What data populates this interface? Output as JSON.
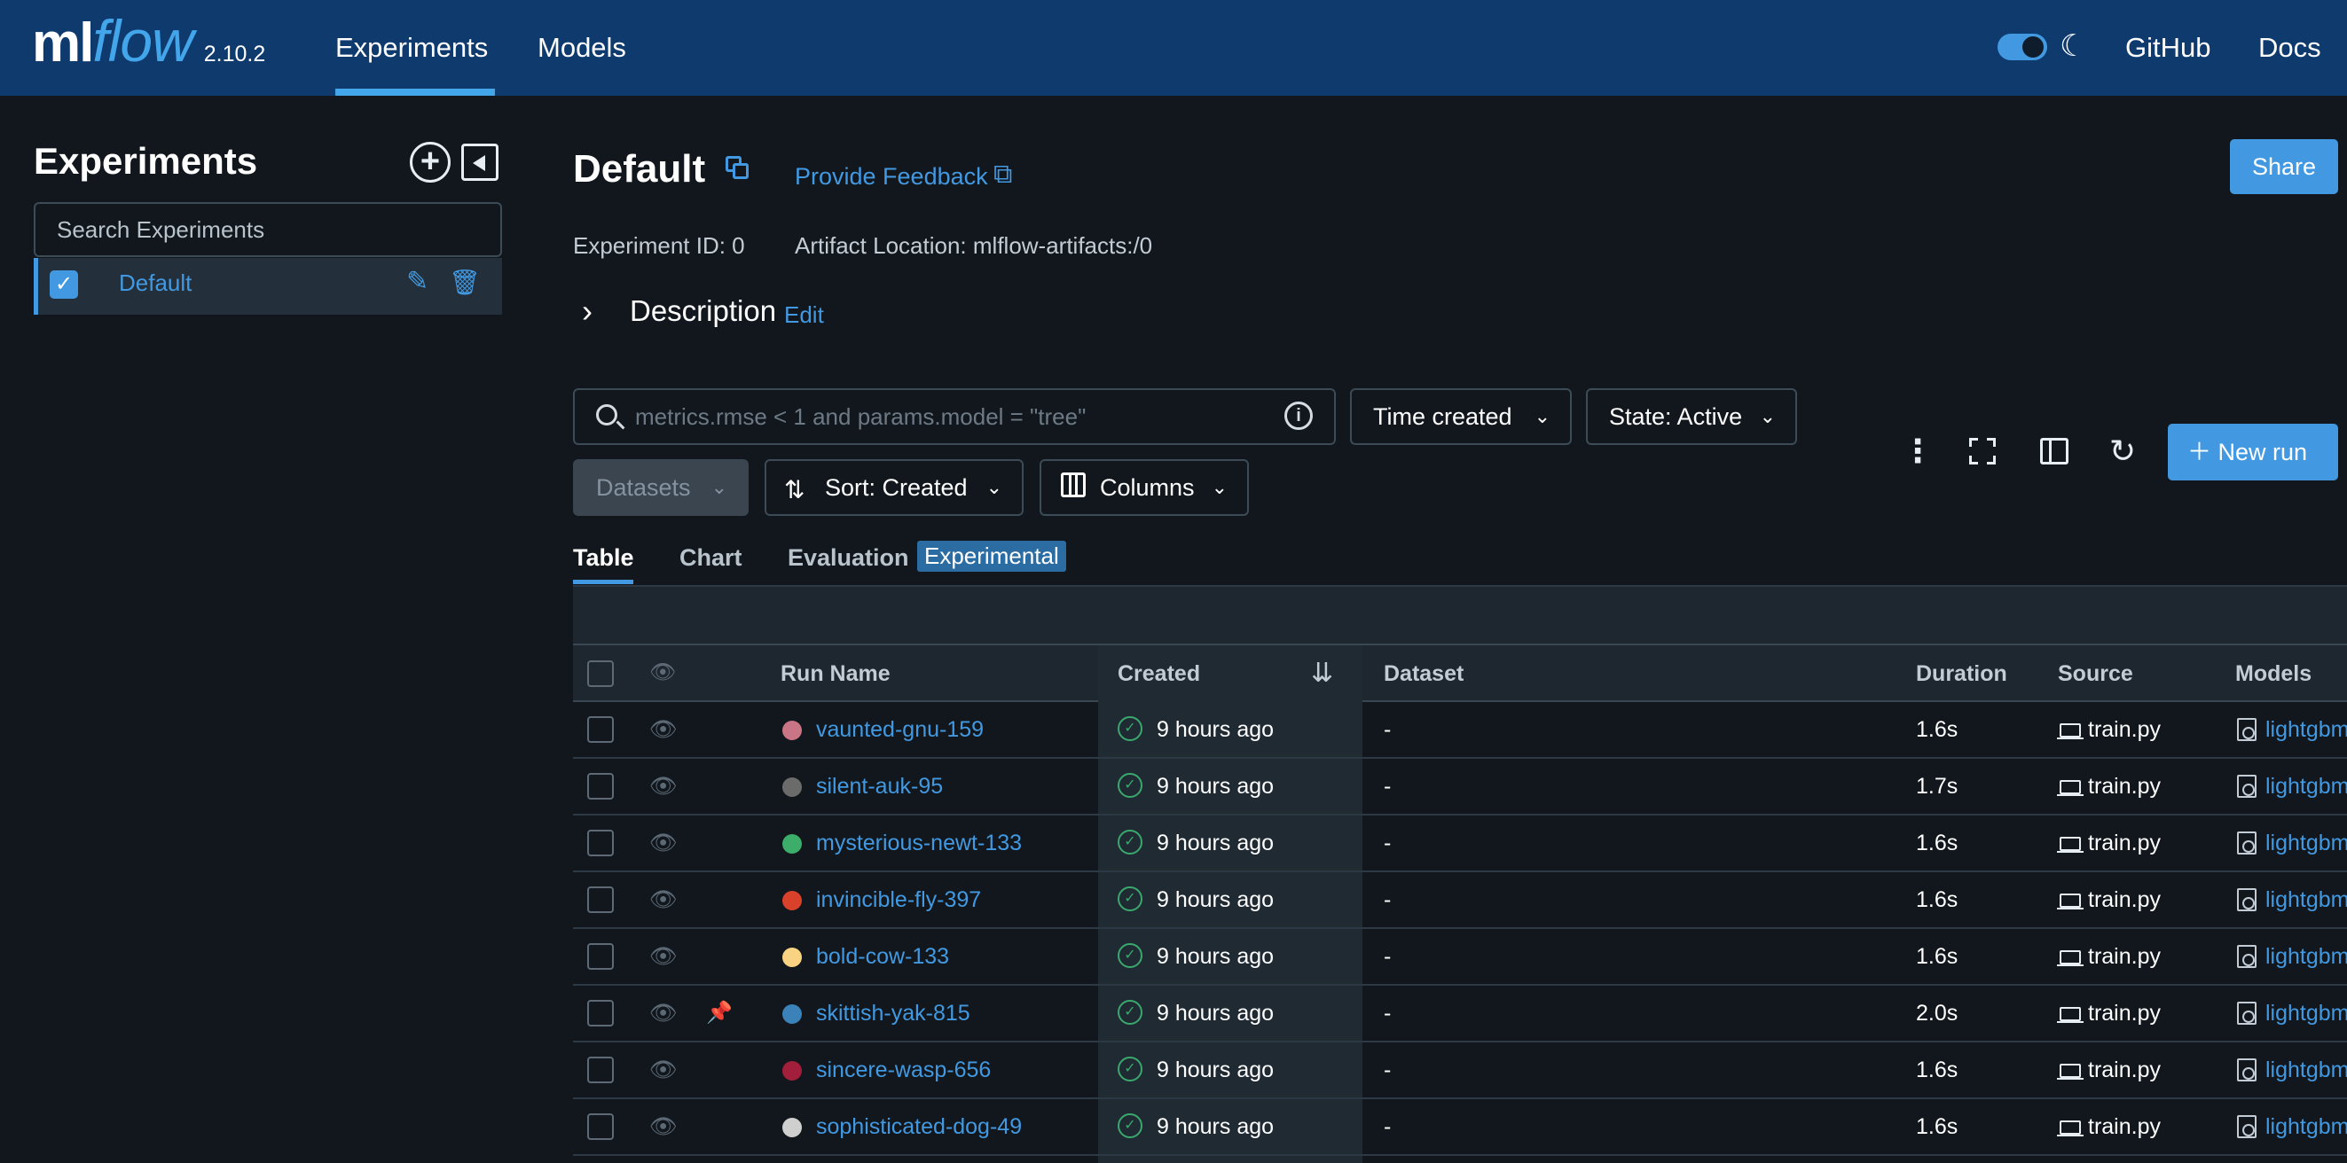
{
  "nav": {
    "logo_ml": "ml",
    "logo_flow": "flow",
    "version": "2.10.2",
    "experiments": "Experiments",
    "models": "Models",
    "github": "GitHub",
    "docs": "Docs"
  },
  "sidebar": {
    "title": "Experiments",
    "search_placeholder": "Search Experiments",
    "items": [
      {
        "label": "Default",
        "checked": true
      }
    ]
  },
  "header": {
    "title": "Default",
    "feedback": "Provide Feedback",
    "share": "Share",
    "experiment_id": "Experiment ID: 0",
    "artifact_location": "Artifact Location: mlflow-artifacts:/0",
    "description": "Description",
    "edit": "Edit"
  },
  "filters": {
    "search_placeholder": "metrics.rmse < 1 and params.model = \"tree\"",
    "time_created": "Time created",
    "state": "State: Active",
    "datasets": "Datasets",
    "sort": "Sort: Created",
    "columns": "Columns",
    "new_run": "New run"
  },
  "tabs": {
    "table": "Table",
    "chart": "Chart",
    "evaluation": "Evaluation",
    "experimental": "Experimental"
  },
  "table": {
    "columns": {
      "run_name": "Run Name",
      "created": "Created",
      "dataset": "Dataset",
      "duration": "Duration",
      "source": "Source",
      "models": "Models"
    },
    "rows": [
      {
        "name": "vaunted-gnu-159",
        "color": "#c97585",
        "created": "9 hours ago",
        "dataset": "-",
        "duration": "1.6s",
        "source": "train.py",
        "model": "lightgbm"
      },
      {
        "name": "silent-auk-95",
        "color": "#6b6b6b",
        "created": "9 hours ago",
        "dataset": "-",
        "duration": "1.7s",
        "source": "train.py",
        "model": "lightgbm"
      },
      {
        "name": "mysterious-newt-133",
        "color": "#3dae6a",
        "created": "9 hours ago",
        "dataset": "-",
        "duration": "1.6s",
        "source": "train.py",
        "model": "lightgbm"
      },
      {
        "name": "invincible-fly-397",
        "color": "#d9412b",
        "created": "9 hours ago",
        "dataset": "-",
        "duration": "1.6s",
        "source": "train.py",
        "model": "lightgbm"
      },
      {
        "name": "bold-cow-133",
        "color": "#f7d382",
        "created": "9 hours ago",
        "dataset": "-",
        "duration": "1.6s",
        "source": "train.py",
        "model": "lightgbm"
      },
      {
        "name": "skittish-yak-815",
        "color": "#3b82b8",
        "created": "9 hours ago",
        "dataset": "-",
        "duration": "2.0s",
        "source": "train.py",
        "model": "lightgbm",
        "pinned": true
      },
      {
        "name": "sincere-wasp-656",
        "color": "#a21f3b",
        "created": "9 hours ago",
        "dataset": "-",
        "duration": "1.6s",
        "source": "train.py",
        "model": "lightgbm"
      },
      {
        "name": "sophisticated-dog-49",
        "color": "#cfcfcf",
        "created": "9 hours ago",
        "dataset": "-",
        "duration": "1.6s",
        "source": "train.py",
        "model": "lightgbm"
      }
    ]
  },
  "colors": {
    "nav_bg": "#0e3a6e",
    "accent": "#4299e1",
    "page_bg": "#11171c",
    "success": "#3aa76d"
  }
}
